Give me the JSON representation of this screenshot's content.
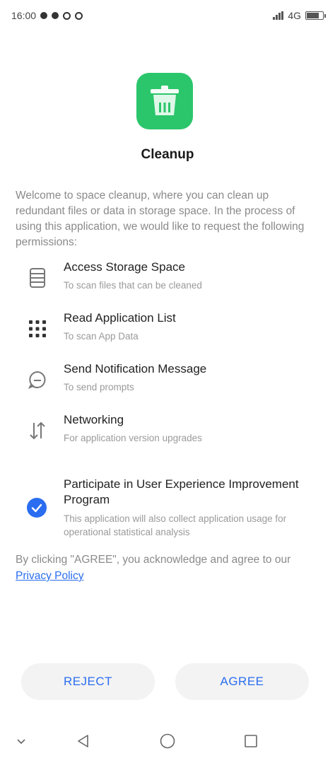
{
  "status_bar": {
    "time": "16:00",
    "left_icons": [
      "notification-dot-icon",
      "notification-dot-icon",
      "notification-count-icon",
      "sync-icon"
    ],
    "right_text": "4G"
  },
  "app": {
    "name": "Cleanup",
    "icon": "trash-can-icon",
    "accent_color": "#2bc66b"
  },
  "intro_text": "Welcome to space cleanup, where you can clean up redundant files or data in storage space. In the process of using this application, we would like to request the following permissions:",
  "permissions": [
    {
      "icon": "storage-icon",
      "title": "Access Storage Space",
      "desc": "To scan files that can be cleaned"
    },
    {
      "icon": "app-grid-icon",
      "title": "Read Application List",
      "desc": "To scan App Data"
    },
    {
      "icon": "notification-bubble-icon",
      "title": "Send Notification Message",
      "desc": "To send prompts"
    },
    {
      "icon": "network-arrows-icon",
      "title": "Networking",
      "desc": "For application version upgrades"
    }
  ],
  "program": {
    "title": "Participate in User Experience Improvement Program",
    "desc": "This application will also collect application usage for operational statistical analysis",
    "checked": true,
    "check_color": "#2a6df0"
  },
  "consent": {
    "text": "By clicking \"AGREE\", you acknowledge and agree to our ",
    "link_text": "Privacy Policy"
  },
  "buttons": {
    "reject": "REJECT",
    "agree": "AGREE"
  },
  "nav": {
    "items": [
      "collapse-chevron-icon",
      "back-triangle-icon",
      "home-circle-icon",
      "recents-square-icon"
    ]
  }
}
